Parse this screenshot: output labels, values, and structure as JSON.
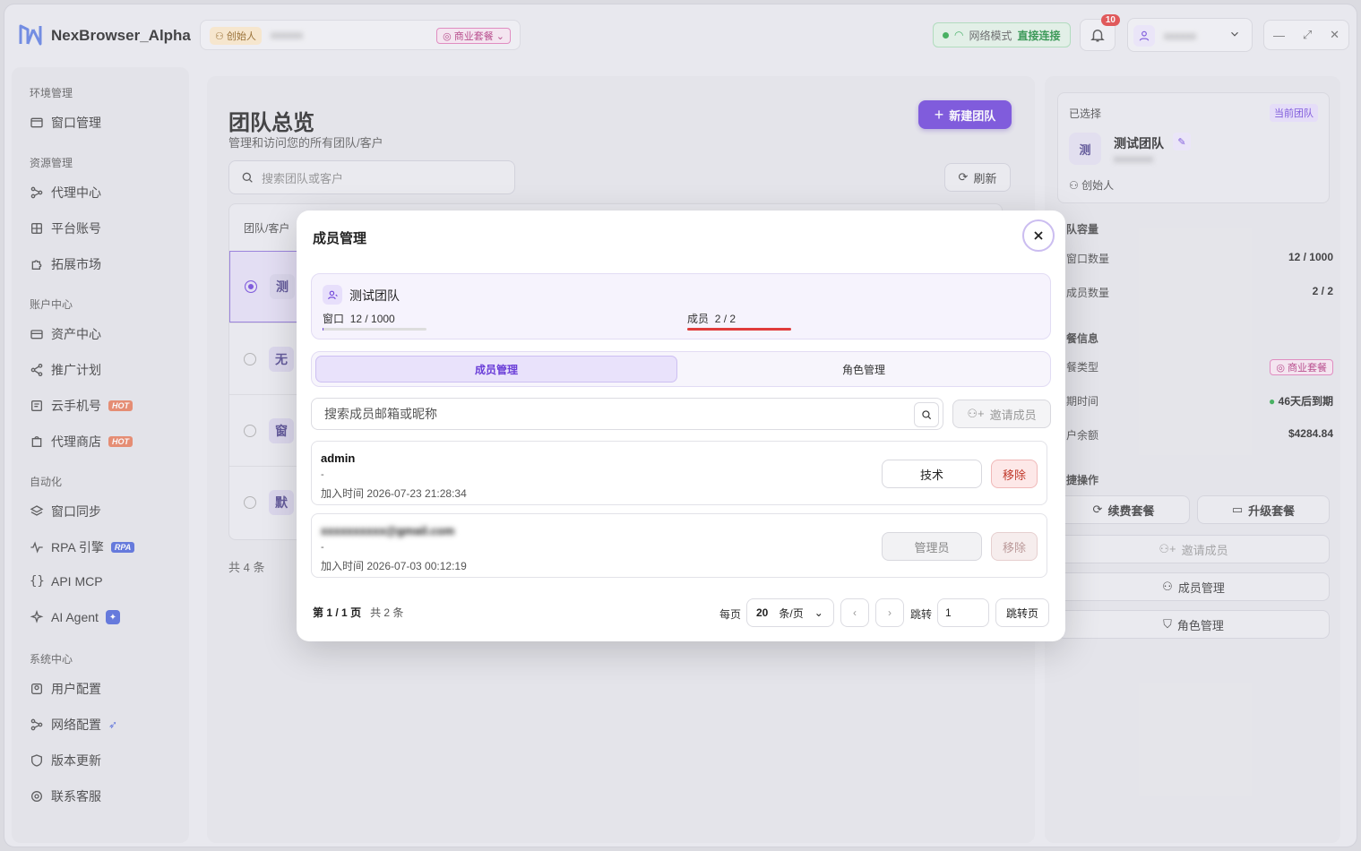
{
  "app": {
    "name": "NexBrowser_Alpha"
  },
  "topbar": {
    "role_chip": "创始人",
    "team_name_blurred": "xxxxxx",
    "plan_chip": "商业套餐",
    "network_label": "网络模式",
    "network_value": "直接连接",
    "notif_count": "10",
    "user_blurred": "xxxxxx"
  },
  "sidebar": {
    "sections": [
      {
        "title": "环境管理",
        "items": [
          {
            "label": "窗口管理",
            "icon": "window-icon"
          }
        ]
      },
      {
        "title": "资源管理",
        "items": [
          {
            "label": "代理中心",
            "icon": "proxy-icon"
          },
          {
            "label": "平台账号",
            "icon": "grid-icon"
          },
          {
            "label": "拓展市场",
            "icon": "puzzle-icon"
          }
        ]
      },
      {
        "title": "账户中心",
        "items": [
          {
            "label": "资产中心",
            "icon": "wallet-icon"
          },
          {
            "label": "推广计划",
            "icon": "share-icon"
          },
          {
            "label": "云手机号",
            "icon": "phone-icon",
            "tag": "HOT"
          },
          {
            "label": "代理商店",
            "icon": "shop-icon",
            "tag": "HOT"
          }
        ]
      },
      {
        "title": "自动化",
        "items": [
          {
            "label": "窗口同步",
            "icon": "layers-icon"
          },
          {
            "label": "RPA 引擎",
            "icon": "pulse-icon",
            "tag": "RPA"
          },
          {
            "label": "API MCP",
            "icon": "braces-icon"
          },
          {
            "label": "AI Agent",
            "icon": "sparkle-icon"
          }
        ]
      },
      {
        "title": "系统中心",
        "items": [
          {
            "label": "用户配置",
            "icon": "user-config-icon"
          },
          {
            "label": "网络配置",
            "icon": "network-icon"
          },
          {
            "label": "版本更新",
            "icon": "shield-icon"
          },
          {
            "label": "联系客服",
            "icon": "support-icon"
          }
        ]
      }
    ]
  },
  "main": {
    "title": "团队总览",
    "subtitle": "管理和访问您的所有团队/客户",
    "search_placeholder": "搜索团队或客户",
    "new_team": "新建团队",
    "refresh": "刷新",
    "table_header": "团队/客户",
    "rows": [
      {
        "avatar": "测",
        "selected": true
      },
      {
        "avatar": "无",
        "selected": false
      },
      {
        "avatar": "窗",
        "selected": false
      },
      {
        "avatar": "默",
        "selected": false
      }
    ],
    "total": "共 4 条"
  },
  "right_panel": {
    "selected_label": "已选择",
    "current_chip": "当前团队",
    "avatar": "测",
    "team_name": "测试团队",
    "team_sub_blurred": "xxxxxxxx",
    "role": "创始人",
    "capacity_title": "队容量",
    "windows_label": "窗口数量",
    "windows_value": "12 / 1000",
    "members_label": "成员数量",
    "members_value": "2 / 2",
    "plan_title": "餐信息",
    "plan_type_label": "餐类型",
    "plan_type_value": "商业套餐",
    "expire_label": "期时间",
    "expire_value": "46天后到期",
    "balance_label": "户余额",
    "balance_value": "$4284.84",
    "quick_title": "捷操作",
    "renew": "续费套餐",
    "upgrade": "升级套餐",
    "invite": "邀请成员",
    "members_mgmt": "成员管理",
    "roles_mgmt": "角色管理"
  },
  "modal": {
    "title": "成员管理",
    "team_name": "测试团队",
    "windows_label": "窗口",
    "windows_value": "12 / 1000",
    "windows_ratio": 0.012,
    "members_label": "成员",
    "members_value": "2 / 2",
    "members_ratio": 1.0,
    "tab_members": "成员管理",
    "tab_roles": "角色管理",
    "search_placeholder": "搜索成员邮箱或昵称",
    "invite": "邀请成员",
    "members": [
      {
        "name": "admin",
        "sub": "-",
        "joined": "加入时间 2026-07-23 21:28:34",
        "role": "技术",
        "remove": "移除",
        "disabled": false
      },
      {
        "name": "xxxxxxxxxx@gmail.com",
        "sub": "-",
        "joined": "加入时间 2026-07-03 00:12:19",
        "role": "管理员",
        "remove": "移除",
        "disabled": true
      }
    ],
    "pager": {
      "page_prefix": "第",
      "page": "1 / 1",
      "page_suffix": "页",
      "total": "共 2 条",
      "per_page_label": "每页",
      "per_page": "20",
      "per_page_unit": "条/页",
      "jump_label": "跳转",
      "jump_value": "1",
      "jump_btn": "跳转页"
    }
  },
  "colors": {
    "accent": "#6b3fd8",
    "danger": "#e03b3b",
    "success": "#28a745"
  }
}
